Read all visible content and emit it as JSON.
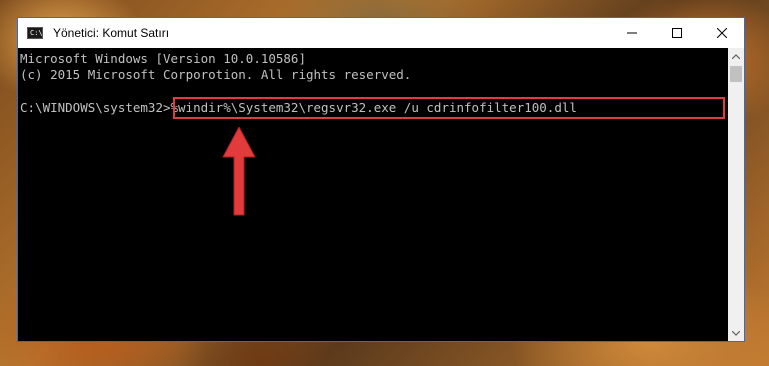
{
  "window": {
    "title": "Yönetici: Komut Satırı",
    "icon": "cmd-icon",
    "icon_label": "C:\\",
    "controls": [
      "minimize-icon",
      "maximize-icon",
      "close-icon"
    ]
  },
  "console": {
    "lines": [
      "Microsoft Windows [Version 10.0.10586]",
      "(c) 2015 Microsoft Corporotion. All rights reserved.",
      ""
    ],
    "prompt": "C:\\WINDOWS\\system32>",
    "command": "%windir%\\System32\\regsvr32.exe /u cdrinfofilter100.dll"
  },
  "annotation": {
    "box_color": "#e23b3b",
    "arrow_color": "#e23b3b"
  }
}
